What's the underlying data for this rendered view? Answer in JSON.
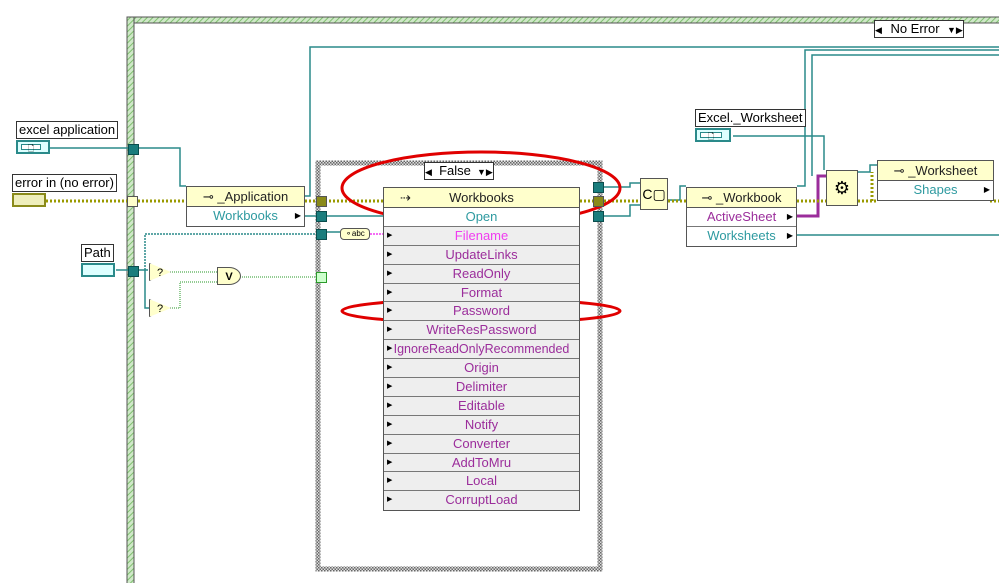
{
  "outer_case": {
    "selector": "No Error"
  },
  "inner_case": {
    "selector": "False"
  },
  "controls": {
    "excel_application": "excel application",
    "error_in": "error in (no error)",
    "path": "Path",
    "excel_worksheet": "Excel._Worksheet"
  },
  "application_node": {
    "class": "_Application",
    "property": "Workbooks"
  },
  "workbooks_node": {
    "class": "Workbooks",
    "method": "Open",
    "parameters": [
      "Filename",
      "UpdateLinks",
      "ReadOnly",
      "Format",
      "Password",
      "WriteResPassword",
      "IgnoreReadOnlyRecommended",
      "Origin",
      "Delimiter",
      "Editable",
      "Notify",
      "Converter",
      "AddToMru",
      "Local",
      "CorruptLoad"
    ]
  },
  "workbook_node": {
    "class": "_Workbook",
    "properties": [
      "ActiveSheet",
      "Worksheets"
    ]
  },
  "worksheet_node": {
    "class": "_Worksheet",
    "property": "Shapes"
  },
  "primitives": {
    "or": "V",
    "empty_path": "?",
    "not_a_path": "?"
  },
  "colors": {
    "refnum_wire": "#2a8a8a",
    "error_wire": "#c8c800",
    "variant_wire": "#9b2d9b",
    "boolean_wire": "#2a9a2a",
    "highlight": "#e00000",
    "node_header": "#ffffcc"
  }
}
